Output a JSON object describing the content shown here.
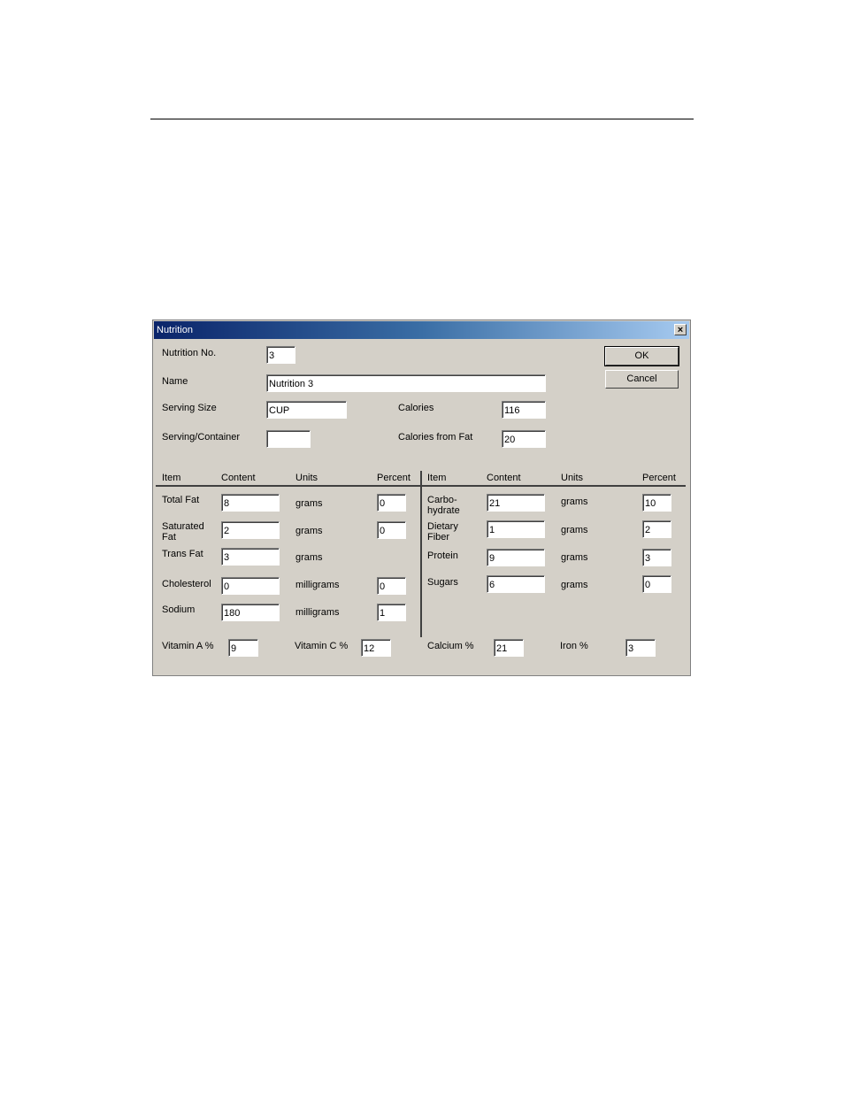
{
  "dialog": {
    "title": "Nutrition",
    "close_glyph": "×",
    "ok_label": "OK",
    "cancel_label": "Cancel"
  },
  "header_fields": {
    "nutrition_no": {
      "label": "Nutrition No.",
      "value": "3"
    },
    "name": {
      "label": "Name",
      "value": "Nutrition 3"
    },
    "serving_size": {
      "label": "Serving Size",
      "value": "CUP"
    },
    "serving_container": {
      "label": "Serving/Container",
      "value": ""
    },
    "calories": {
      "label": "Calories",
      "value": "116"
    },
    "calories_from_fat": {
      "label": "Calories from Fat",
      "value": "20"
    }
  },
  "columns": {
    "item": "Item",
    "content": "Content",
    "units": "Units",
    "percent": "Percent"
  },
  "left_rows": [
    {
      "item": "Total Fat",
      "content": "8",
      "units": "grams",
      "percent": "0"
    },
    {
      "item": "Saturated\nFat",
      "content": "2",
      "units": "grams",
      "percent": "0"
    },
    {
      "item": "Trans Fat",
      "content": "3",
      "units": "grams",
      "percent": null
    },
    {
      "item": "Cholesterol",
      "content": "0",
      "units": "milligrams",
      "percent": "0"
    },
    {
      "item": "Sodium",
      "content": "180",
      "units": "milligrams",
      "percent": "1"
    }
  ],
  "right_rows": [
    {
      "item": "Carbo-\nhydrate",
      "content": "21",
      "units": "grams",
      "percent": "10"
    },
    {
      "item": "Dietary\nFiber",
      "content": "1",
      "units": "grams",
      "percent": "2"
    },
    {
      "item": "Protein",
      "content": "9",
      "units": "grams",
      "percent": "3"
    },
    {
      "item": "Sugars",
      "content": "6",
      "units": "grams",
      "percent": "0"
    }
  ],
  "vitamins": {
    "vitamin_a": {
      "label": "Vitamin A %",
      "value": "9"
    },
    "vitamin_c": {
      "label": "Vitamin C %",
      "value": "12"
    },
    "calcium": {
      "label": "Calcium %",
      "value": "21"
    },
    "iron": {
      "label": "Iron %",
      "value": "3"
    }
  }
}
